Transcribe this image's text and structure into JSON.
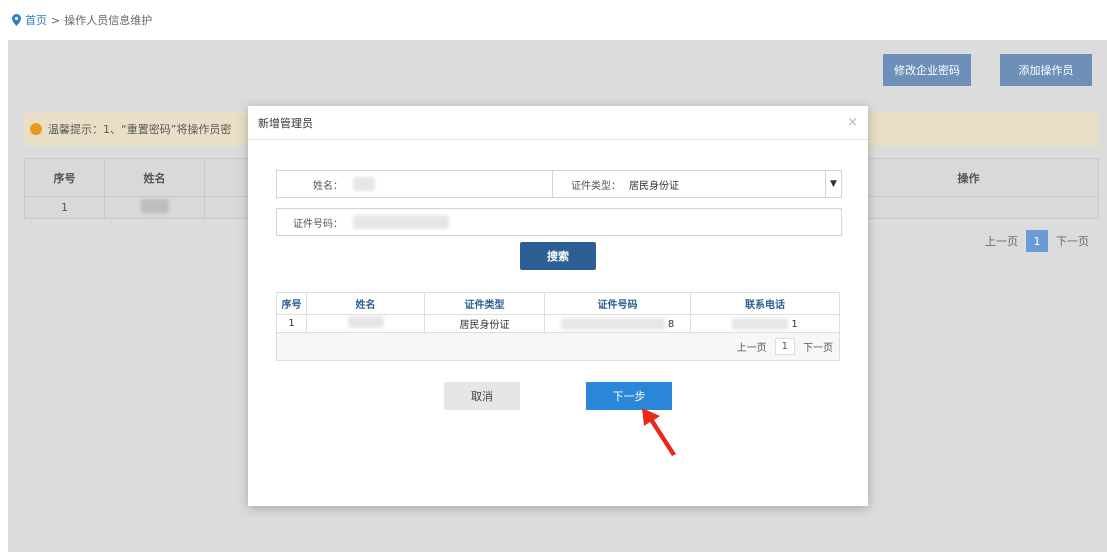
{
  "breadcrumb": {
    "home": "首页",
    "separator": ">",
    "current": "操作人员信息维护"
  },
  "top_buttons": {
    "modify_password": "修改企业密码",
    "add_operator": "添加操作员"
  },
  "tip": {
    "text": "温馨提示：1、“重置密码”将操作员密"
  },
  "bg_table": {
    "headers": [
      "序号",
      "姓名",
      "",
      "操作"
    ],
    "rows": [
      [
        "1",
        "",
        "",
        ""
      ]
    ]
  },
  "bg_pager": {
    "prev": "上一页",
    "current": "1",
    "next": "下一页"
  },
  "modal": {
    "title": "新增管理员",
    "close": "×",
    "name_label": "姓名：",
    "id_type_label": "证件类型：",
    "id_type_value": "居民身份证",
    "id_number_label": "证件号码：",
    "search_button": "搜索",
    "results": {
      "headers": [
        "序号",
        "姓名",
        "证件类型",
        "证件号码",
        "联系电话"
      ],
      "rows": [
        {
          "index": "1",
          "name": "",
          "id_type": "居民身份证",
          "id_number_tail": "8",
          "phone_tail": "1"
        }
      ],
      "pager": {
        "prev": "上一页",
        "current": "1",
        "next": "下一页"
      }
    },
    "cancel_button": "取消",
    "next_button": "下一步"
  },
  "colors": {
    "accent": "#2a86d6",
    "search": "#2d5f97",
    "annotation_arrow": "#e8281c"
  }
}
